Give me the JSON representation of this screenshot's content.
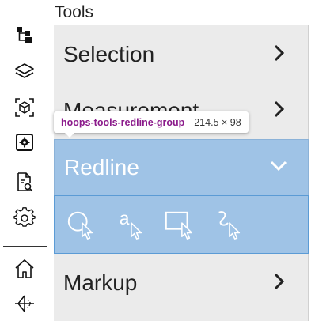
{
  "toolbar": {
    "items": [
      {
        "name": "model-tree-icon"
      },
      {
        "name": "layers-icon"
      },
      {
        "name": "cube-view-icon"
      },
      {
        "name": "settings-panel-icon"
      },
      {
        "name": "document-search-icon"
      },
      {
        "name": "gear-icon"
      },
      {
        "name": "home-icon"
      },
      {
        "name": "view-cut-icon"
      }
    ]
  },
  "panel": {
    "title": "Tools",
    "groups": {
      "selection": "Selection",
      "measurement": "Measurement",
      "redline": "Redline",
      "markup": "Markup"
    },
    "redline_tools": [
      {
        "name": "redline-circle-tool"
      },
      {
        "name": "redline-text-tool",
        "glyph": "a"
      },
      {
        "name": "redline-rectangle-tool"
      },
      {
        "name": "redline-freehand-tool"
      }
    ]
  },
  "tooltip": {
    "element": "hoops-tools-redline-group",
    "size": "214.5 × 98"
  },
  "colors": {
    "accent": "#9fc3e6",
    "accent_border": "#5b9bd5",
    "tooltip_name": "#8b1a8b"
  }
}
